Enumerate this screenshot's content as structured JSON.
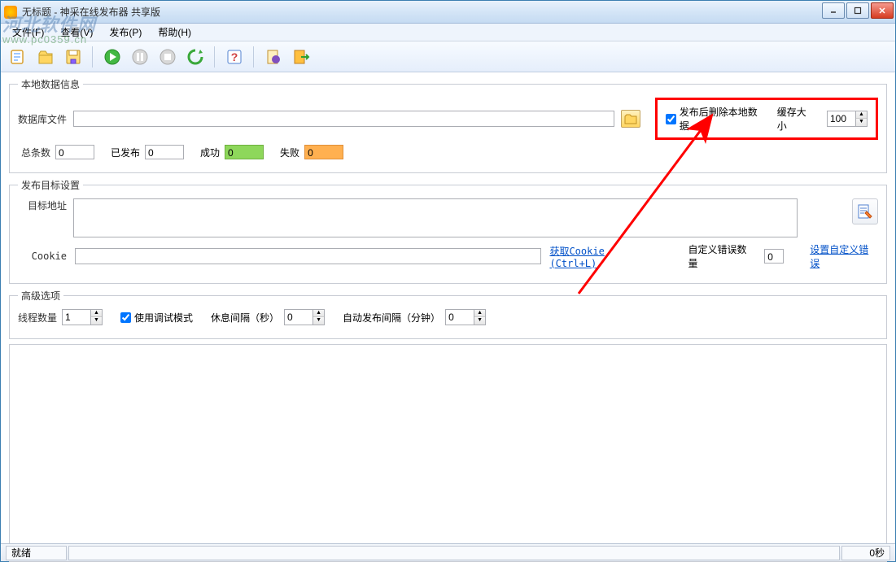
{
  "window": {
    "title": "无标题 - 神采在线发布器 共享版"
  },
  "watermark": {
    "text": "河北软件网",
    "url": "www.pc0359.cn"
  },
  "menu": {
    "file": "文件(F)",
    "view": "查看(V)",
    "publish": "发布(P)",
    "help": "帮助(H)"
  },
  "section_local": {
    "legend": "本地数据信息",
    "db_file_label": "数据库文件",
    "db_file_value": "",
    "total_label": "总条数",
    "total_value": "0",
    "published_label": "已发布",
    "published_value": "0",
    "success_label": "成功",
    "success_value": "0",
    "fail_label": "失败",
    "fail_value": "0",
    "delete_after_label": "发布后删除本地数据",
    "cache_size_label": "缓存大小",
    "cache_size_value": "100"
  },
  "section_target": {
    "legend": "发布目标设置",
    "target_url_label": "目标地址",
    "target_url_value": "",
    "cookie_label": "Cookie",
    "cookie_value": "",
    "get_cookie_link": "获取Cookie (Ctrl+L)",
    "custom_error_label": "自定义错误数量",
    "custom_error_value": "0",
    "set_custom_error_link": "设置自定义错误"
  },
  "section_advanced": {
    "legend": "高级选项",
    "threads_label": "线程数量",
    "threads_value": "1",
    "debug_mode_label": "使用调试模式",
    "rest_interval_label": "休息间隔（秒）",
    "rest_interval_value": "0",
    "auto_publish_label": "自动发布间隔（分钟）",
    "auto_publish_value": "0"
  },
  "status": {
    "ready": "就绪",
    "time": "0秒"
  }
}
